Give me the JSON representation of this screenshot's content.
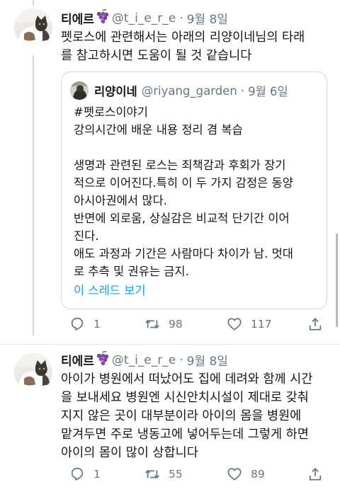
{
  "tweets": [
    {
      "display_name": "티에르",
      "handle": "@t_i_e_r_e",
      "separator": "·",
      "time": "9월 8일",
      "lines": [
        "펫로스에 관련해서는 아래의 리양이네님의 타래",
        "를 참고하시면 도움이 될 것 같습니다"
      ],
      "quote": {
        "display_name": "리양이네",
        "handle": "@riyang_garden",
        "separator": "·",
        "time": "9월 6일",
        "lines": [
          "#펫로스이야기",
          "강의시간에 배운 내용 정리 겸 복습",
          "",
          "생명과 관련된 로스는 죄책감과 후회가 장기",
          "적으로 이어진다.특히 이 두 가지 감정은 동양",
          "아시아권에서 많다.",
          "반면에 외로움, 상실감은 비교적 단기간 이어",
          "진다.",
          "애도 과정과 기간은 사람마다 차이가 남. 멋대",
          "로 추측 및 권유는 금지."
        ],
        "show_thread": "이 스레드 보기"
      },
      "stats": {
        "replies": "1",
        "retweets": "98",
        "likes": "117"
      }
    },
    {
      "display_name": "티에르",
      "handle": "@t_i_e_r_e",
      "separator": "·",
      "time": "9월 8일",
      "lines": [
        "아이가 병원에서 떠났어도 집에 데려와 함께 시간",
        "을 보내세요 병원엔 시신안치시설이 제대로 갖춰",
        "지지 않은 곳이 대부분이라 아이의 몸을 병원에",
        "맡겨두면 주로 냉동고에 넣어두는데 그렇게 하면",
        "아이의 몸이 많이 상합니다"
      ],
      "stats": {
        "replies": "1",
        "retweets": "55",
        "likes": "89"
      }
    }
  ],
  "icons": {
    "name_emoji": "grapes-emoji-icon",
    "reply": "reply-icon",
    "retweet": "retweet-icon",
    "like": "heart-icon",
    "share": "share-icon"
  },
  "colors": {
    "text": "#14171a",
    "secondary": "#657786",
    "link": "#1da1f2",
    "border": "#ccd6dd",
    "emoji": "#7b3fa0"
  }
}
